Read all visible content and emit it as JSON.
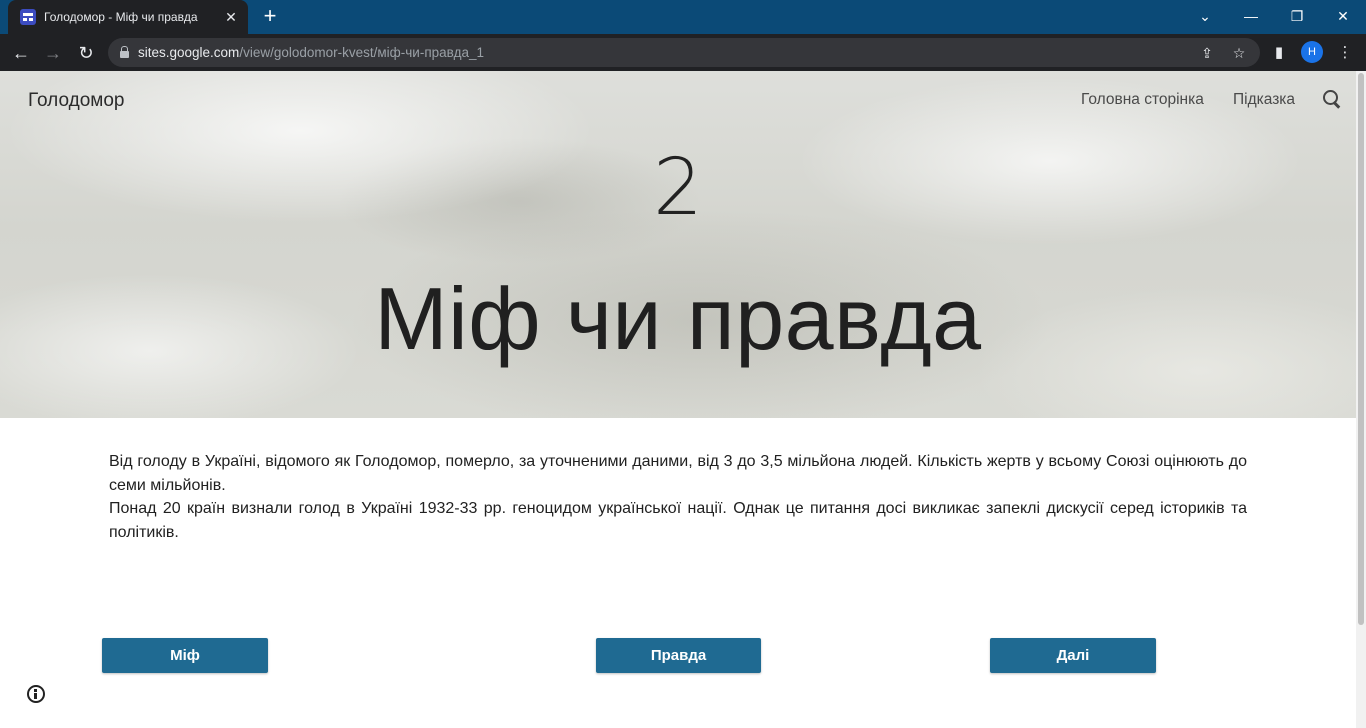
{
  "browser": {
    "tab_title": "Голодомор - Міф чи правда",
    "tab_close": "✕",
    "new_tab": "+",
    "window_controls": {
      "dropdown": "⌄",
      "minimize": "—",
      "restore": "❐",
      "close": "✕"
    },
    "url_host": "sites.google.com",
    "url_path": "/view/golodomor-kvest/міф-чи-правда_1",
    "profile_initial": "H",
    "nav": {
      "back": "←",
      "forward": "→",
      "reload": "↻"
    },
    "toolbar_icons": {
      "share": "⇪",
      "star": "☆",
      "side_panel": "▮",
      "menu": "⋮"
    }
  },
  "site": {
    "title": "Голодомор",
    "nav": {
      "home": "Головна сторінка",
      "hint": "Підказка"
    }
  },
  "hero": {
    "number": "2",
    "heading": "Міф чи правда"
  },
  "body": {
    "paragraph1": "Від голоду в Україні, відомого як Голодомор, померло, за уточненими даними, від 3 до 3,5 мільйона людей. Кількість жертв у всьому Союзі оцінюють до семи мільйонів.",
    "paragraph2": "Понад 20 країн визнали голод в Україні 1932-33 рр. геноцидом української нації. Однак це питання досі викликає запеклі дискусії серед істориків та політиків."
  },
  "buttons": {
    "myth": "Міф",
    "truth": "Правда",
    "next": "Далі"
  },
  "colors": {
    "button_bg": "#1f6a92",
    "tabbar_bg": "#0b4a77",
    "toolbar_bg": "#202124"
  }
}
